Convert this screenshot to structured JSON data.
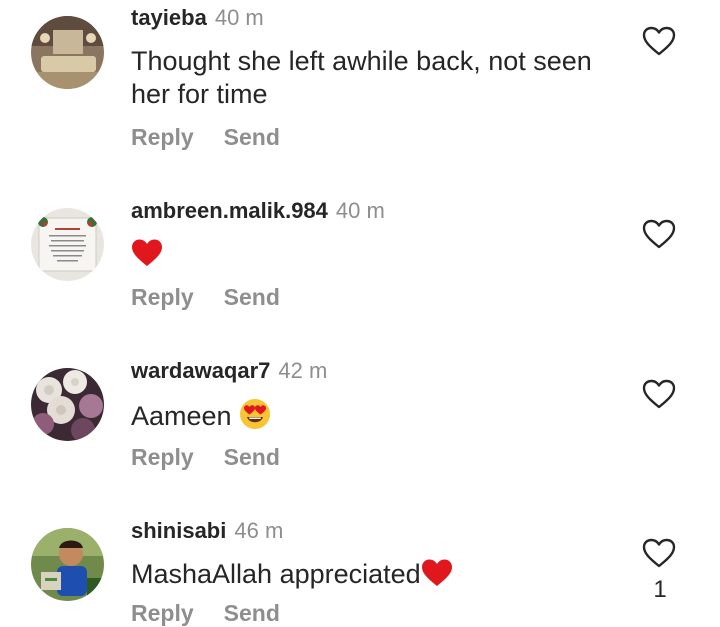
{
  "comments": [
    {
      "username": "tayieba",
      "time": "40 m",
      "text": "Thought she left awhile back, not seen her for time",
      "reply_label": "Reply",
      "send_label": "Send"
    },
    {
      "username": "ambreen.malik.984",
      "time": "40 m",
      "text": "",
      "emoji": "red-heart",
      "reply_label": "Reply",
      "send_label": "Send"
    },
    {
      "username": "wardawaqar7",
      "time": "42 m",
      "text": "Aameen",
      "emoji": "heart-eyes-face",
      "reply_label": "Reply",
      "send_label": "Send"
    },
    {
      "username": "shinisabi",
      "time": "46 m",
      "text": "MashaAllah appreciated",
      "emoji": "red-heart",
      "like_count": "1",
      "reply_label": "Reply",
      "send_label": "Send"
    }
  ],
  "icons": {
    "like": "heart-outline-icon",
    "heart_emoji_color": "#e0181e",
    "heart_eyes_face_color": "#f7c531"
  }
}
